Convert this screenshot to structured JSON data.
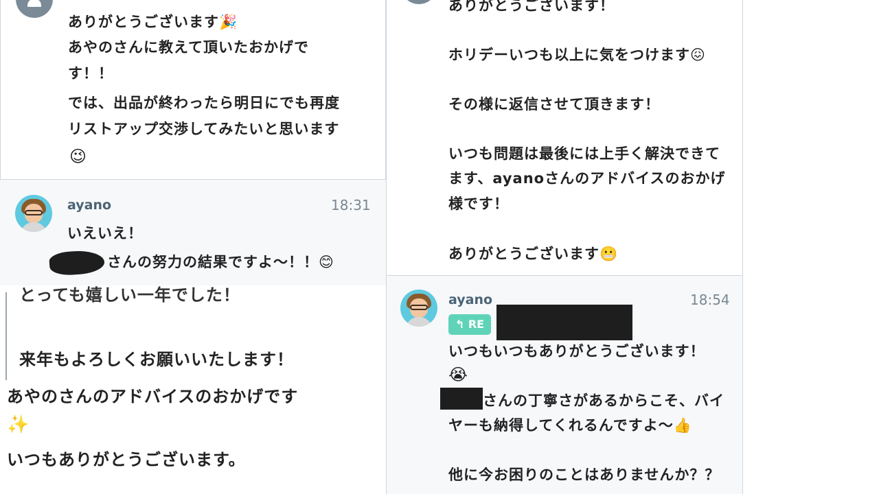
{
  "panel_top_left": {
    "lines": [
      "ありがとうございます🎉",
      "あやのさんに教えて頂いたおかげで",
      "す！！",
      "では、出品が終わったら明日にでも再度",
      "リストアップ交渉してみたいと思います",
      "😉"
    ]
  },
  "panel_mid_left": {
    "author": "ayano",
    "time": "18:31",
    "lines": [
      "いえいえ！",
      "さんの努力の結果ですよ〜！！😊"
    ]
  },
  "panel_bottom_left": {
    "quote_partial": "とっても嬉しい一年でした！",
    "quote_line": "来年もよろしくお願いいたします！",
    "lines": [
      "あやのさんのアドバイスのおかげです",
      "✨",
      "いつもありがとうございます。"
    ]
  },
  "panel_top_right": {
    "lines": [
      "ありがとうございます！",
      "ホリデーいつも以上に気をつけます😖",
      "その様に返信させて頂きます！",
      "いつも問題は最後には上手く解決できて",
      "ます、ayanoさんのアドバイスのおかげ",
      "様です！",
      "ありがとうございます😬"
    ]
  },
  "panel_bottom_right": {
    "author": "ayano",
    "time": "18:54",
    "reply_badge": "↰ RE",
    "lines": [
      "いつもいつもありがとうございます！",
      "😭",
      "さんの丁寧さがあるからこそ、バイ",
      "ヤーも納得してくれるんですよ〜👍",
      "他に今お困りのことはありませんか？？"
    ]
  },
  "colors": {
    "panel_bg_light": "#f6f8fa",
    "border": "#cfd6de",
    "name_color": "#4a6375",
    "time_color": "#7b8790",
    "re_badge": "#5fd3b8",
    "avatar_bg": "#5fc9e0"
  }
}
